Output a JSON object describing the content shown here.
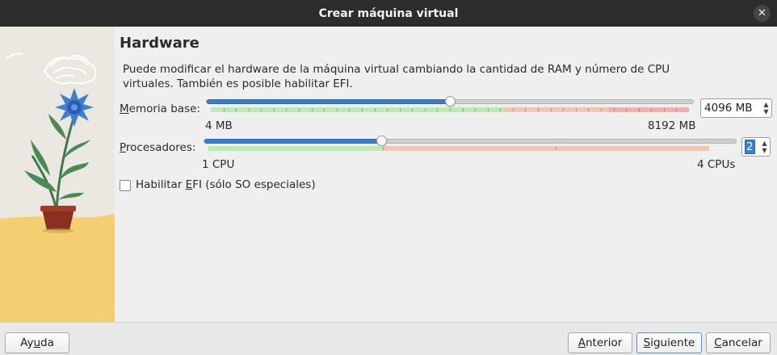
{
  "window": {
    "title": "Crear máquina virtual"
  },
  "page": {
    "heading": "Hardware",
    "description": "Puede modificar el hardware de la máquina virtual cambiando la cantidad de RAM y número de CPU virtuales. También es posible habilitar EFI."
  },
  "memory": {
    "label_prefix": "M",
    "label_rest": "emoria base:",
    "min_label": "4 MB",
    "max_label": "8192 MB",
    "value_text": "4096 MB",
    "value_fraction": 0.5
  },
  "cpu": {
    "label_prefix": "P",
    "label_rest": "rocesadores:",
    "min_label": "1 CPU",
    "max_label": "4 CPUs",
    "value_text": "2",
    "value_fraction": 0.333
  },
  "efi": {
    "label_before": "Habilitar ",
    "label_mnemonic": "E",
    "label_after": "FI (sólo SO especiales)",
    "checked": false
  },
  "footer": {
    "help_prefix": "Ay",
    "help_mnemonic": "u",
    "help_rest": "da",
    "back_mnemonic": "A",
    "back_rest": "nterior",
    "next_mnemonic": "S",
    "next_rest": "iguiente",
    "cancel_mnemonic": "C",
    "cancel_rest": "ancelar"
  },
  "colors": {
    "slider_accent": "#3a7fcf",
    "zone_ok": "#b9ecb0",
    "zone_warn": "#f3c6b3",
    "zone_bad": "#f2aeb0",
    "titlebar": "#2c2c2c"
  }
}
